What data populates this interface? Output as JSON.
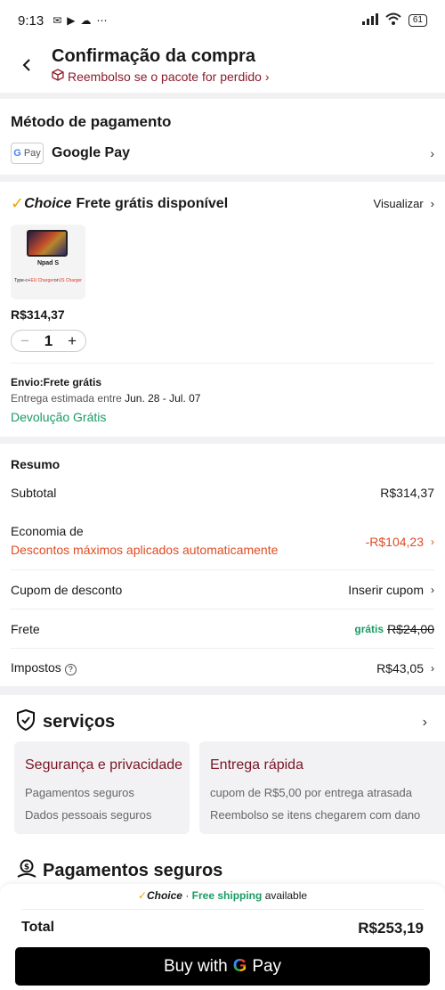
{
  "status_bar": {
    "time": "9:13",
    "battery": "61"
  },
  "header": {
    "title": "Confirmação da compra",
    "refund_text": "Reembolso se o pacote for perdido",
    "refund_chevron": "›"
  },
  "payment": {
    "title": "Método de pagamento",
    "logo_g": "G",
    "logo_pay": "Pay",
    "method": "Google Pay"
  },
  "order": {
    "choice_word": "Choice",
    "title": "Frete grátis disponível",
    "view_label": "Visualizar",
    "product": {
      "name": "Npad S",
      "accessories": [
        "Type-c",
        "+",
        "EU Charger",
        "or",
        "US Charger"
      ],
      "price": "R$314,37",
      "quantity": "1",
      "minus": "−",
      "plus": "+"
    },
    "shipping_label": "Envio:Frete grátis",
    "estimate_prefix": "Entrega estimada entre",
    "estimate_dates": "Jun. 28 - Jul. 07",
    "returns": "Devolução Grátis"
  },
  "summary": {
    "title": "Resumo",
    "subtotal_label": "Subtotal",
    "subtotal_value": "R$314,37",
    "savings_label": "Economia de",
    "savings_sub": "Descontos máximos aplicados automaticamente",
    "savings_value": "-R$104,23",
    "coupon_label": "Cupom de desconto",
    "coupon_value": "Inserir cupom",
    "shipping_label": "Frete",
    "shipping_free": "grátis",
    "shipping_old": "R$24,00",
    "taxes_label": "Impostos",
    "taxes_value": "R$43,05"
  },
  "services": {
    "title": "serviços",
    "security_title": "Segurança e privacidade",
    "security_items": [
      "Pagamentos seguros",
      "Dados pessoais seguros"
    ],
    "delivery_title": "Entrega rápida",
    "delivery_items": [
      "cupom de R$5,00 por entrega atrasada",
      "Reembolso se itens chegarem com dano"
    ],
    "secure_payments_title": "Pagamentos seguros"
  },
  "footer": {
    "banner_choice": "Choice",
    "banner_sep": "·",
    "banner_free": "Free shipping",
    "banner_available": "available",
    "total_label": "Total",
    "total_value": "R$253,19",
    "buy_label": "Buy with",
    "buy_g": "G",
    "buy_pay": "Pay"
  },
  "colors": {
    "accent_red": "#e04c23",
    "green": "#1a9b64",
    "choice_gold": "#f0a400",
    "maroon": "#7a1424"
  }
}
